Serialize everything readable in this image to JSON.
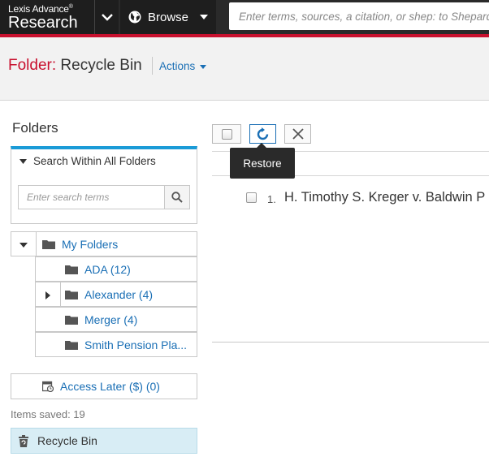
{
  "topbar": {
    "brand_small": "Lexis Advance",
    "brand_reg": "®",
    "brand_main": "Research",
    "browse_label": "Browse",
    "search_placeholder": "Enter terms, sources, a citation, or shep: to Shepardize®"
  },
  "header": {
    "folder_label": "Folder:",
    "folder_name": "Recycle Bin",
    "actions_label": "Actions"
  },
  "sidebar": {
    "title": "Folders",
    "search_within_label": "Search Within All Folders",
    "search_placeholder": "Enter search terms",
    "my_folders_label": "My Folders",
    "folders": [
      {
        "label": "ADA (12)",
        "expandable": false
      },
      {
        "label": "Alexander (4)",
        "expandable": true
      },
      {
        "label": "Merger (4)",
        "expandable": false
      },
      {
        "label": "Smith Pension Pla...",
        "expandable": false
      }
    ],
    "access_later_label": "Access Later ($) (0)",
    "items_saved_label": "Items saved: 19",
    "recycle_bin_label": "Recycle Bin"
  },
  "main": {
    "tooltip": "Restore",
    "documents": [
      {
        "number": "1.",
        "title": "H. Timothy S. Kreger v. Baldwin P"
      }
    ]
  },
  "colors": {
    "accent_red": "#c8102e",
    "link_blue": "#1a6fb5",
    "search_accent": "#1a9bd7",
    "selected_bg": "#d8edf5"
  }
}
